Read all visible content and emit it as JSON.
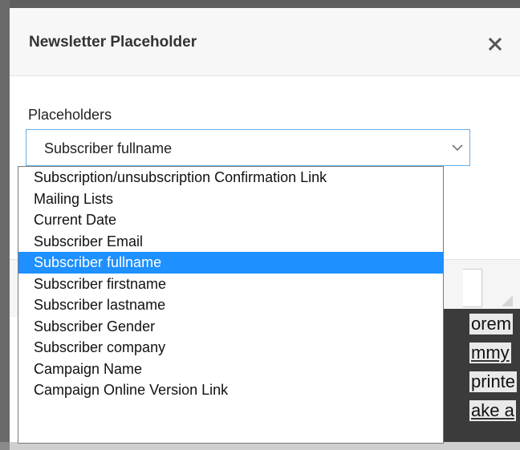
{
  "dialog": {
    "title": "Newsletter Placeholder",
    "close_symbol": "✕"
  },
  "field": {
    "label": "Placeholders",
    "selected_value": "Subscriber fullname"
  },
  "dropdown": {
    "options": [
      "Subscription/unsubscription Confirmation Link",
      "Mailing Lists",
      "Current Date",
      "Subscriber Email",
      "Subscriber fullname",
      "Subscriber firstname",
      "Subscriber lastname",
      "Subscriber Gender",
      "Subscriber company",
      "Campaign Name",
      "Campaign Online Version Link"
    ],
    "highlighted_index": 4
  },
  "background_editor": {
    "lines": [
      "orem",
      "mmy",
      "printe",
      "ake a"
    ]
  },
  "colors": {
    "highlight": "#1e90ff",
    "focus_border": "#66afe9",
    "header_bg": "#f7f7f7"
  }
}
